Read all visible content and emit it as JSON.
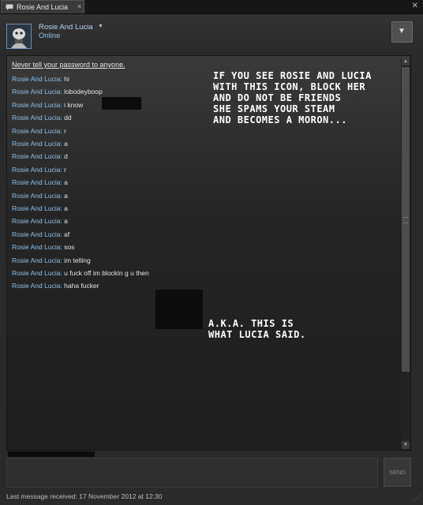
{
  "tab": {
    "label": "Rosie And Lucia",
    "close": "×"
  },
  "window": {
    "close": "✕"
  },
  "header": {
    "friend_name": "Rosie And Lucia",
    "dropdown": "▼",
    "status": "Online",
    "menu": "▼"
  },
  "chat": {
    "warning": "Never tell your password to anyone.",
    "messages": [
      {
        "sender": "Rosie And Lucia",
        "text": "hi"
      },
      {
        "sender": "Rosie And Lucia",
        "text": "lobodeyboop"
      },
      {
        "sender": "Rosie And Lucia",
        "text": "i know"
      },
      {
        "sender": "Rosie And Lucia",
        "text": "dd"
      },
      {
        "sender": "Rosie And Lucia",
        "text": "r"
      },
      {
        "sender": "Rosie And Lucia",
        "text": "a"
      },
      {
        "sender": "Rosie And Lucia",
        "text": "d"
      },
      {
        "sender": "Rosie And Lucia",
        "text": "r"
      },
      {
        "sender": "Rosie And Lucia",
        "text": "a"
      },
      {
        "sender": "Rosie And Lucia",
        "text": "a"
      },
      {
        "sender": "Rosie And Lucia",
        "text": "a"
      },
      {
        "sender": "Rosie And Lucia",
        "text": "a"
      },
      {
        "sender": "Rosie And Lucia",
        "text": "af"
      },
      {
        "sender": "Rosie And Lucia",
        "text": "sos"
      },
      {
        "sender": "Rosie And Lucia",
        "text": "im telling"
      },
      {
        "sender": "Rosie And Lucia",
        "text": "u fuck off im blockin g u then"
      },
      {
        "sender": "Rosie And Lucia",
        "text": "haha fucker"
      }
    ],
    "annotation_1": [
      "If you see Rosie and Lucia",
      "with this icon, block her",
      "and do not be friends",
      "she spams your steam",
      "and becomes a moron..."
    ],
    "annotation_2": [
      "A.K.A. this is",
      "what Lucia said."
    ]
  },
  "scrollbar": {
    "up": "▲",
    "down": "▼"
  },
  "composer": {
    "send_label": "SEND"
  },
  "footer": {
    "last_message": "Last message received: 17 November 2012 at 12:30"
  }
}
